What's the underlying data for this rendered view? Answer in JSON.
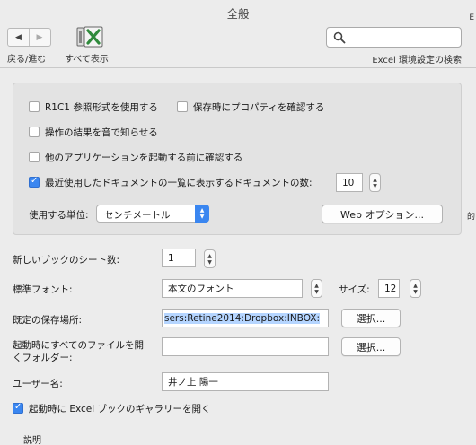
{
  "window": {
    "title": "全般"
  },
  "edge_chars": [
    "E",
    "的"
  ],
  "toolbar": {
    "back_glyph": "◀",
    "forward_glyph": "▶",
    "back_forward_label": "戻る/進む",
    "show_all_label": "すべて表示",
    "search_value": "",
    "search_label": "Excel 環境設定の検索"
  },
  "group": {
    "r1c1_label": "R1C1 参照形式を使用する",
    "r1c1_checked": false,
    "prompt_properties_label": "保存時にプロパティを確認する",
    "prompt_properties_checked": false,
    "feedback_sound_label": "操作の結果を音で知らせる",
    "feedback_sound_checked": false,
    "confirm_other_apps_label": "他のアプリケーションを起動する前に確認する",
    "confirm_other_apps_checked": false,
    "recent_docs_label": "最近使用したドキュメントの一覧に表示するドキュメントの数:",
    "recent_docs_checked": true,
    "recent_docs_count": "10",
    "unit_label": "使用する単位:",
    "unit_value": "センチメートル",
    "web_options_button": "Web オプション..."
  },
  "main": {
    "sheets_label": "新しいブックのシート数:",
    "sheets_value": "1",
    "font_label": "標準フォント:",
    "font_value": "本文のフォント",
    "size_label": "サイズ:",
    "size_value": "12",
    "save_location_label": "既定の保存場所:",
    "save_location_value": "sers:Retine2014:Dropbox:INBOX:",
    "select_button": "選択...",
    "startup_folder_label_line1": "起動時にすべてのファイルを開",
    "startup_folder_label_line2": "くフォルダー:",
    "startup_folder_value": "",
    "select_button_2": "選択...",
    "username_label": "ユーザー名:",
    "username_value": "井ノ上 陽一",
    "gallery_label": "起動時に Excel ブックのギャラリーを開く",
    "gallery_checked": true,
    "description_label": "説明"
  },
  "colors": {
    "accent": "#3a86f0",
    "selection": "#b5d5ff",
    "window_bg": "#ececec"
  }
}
